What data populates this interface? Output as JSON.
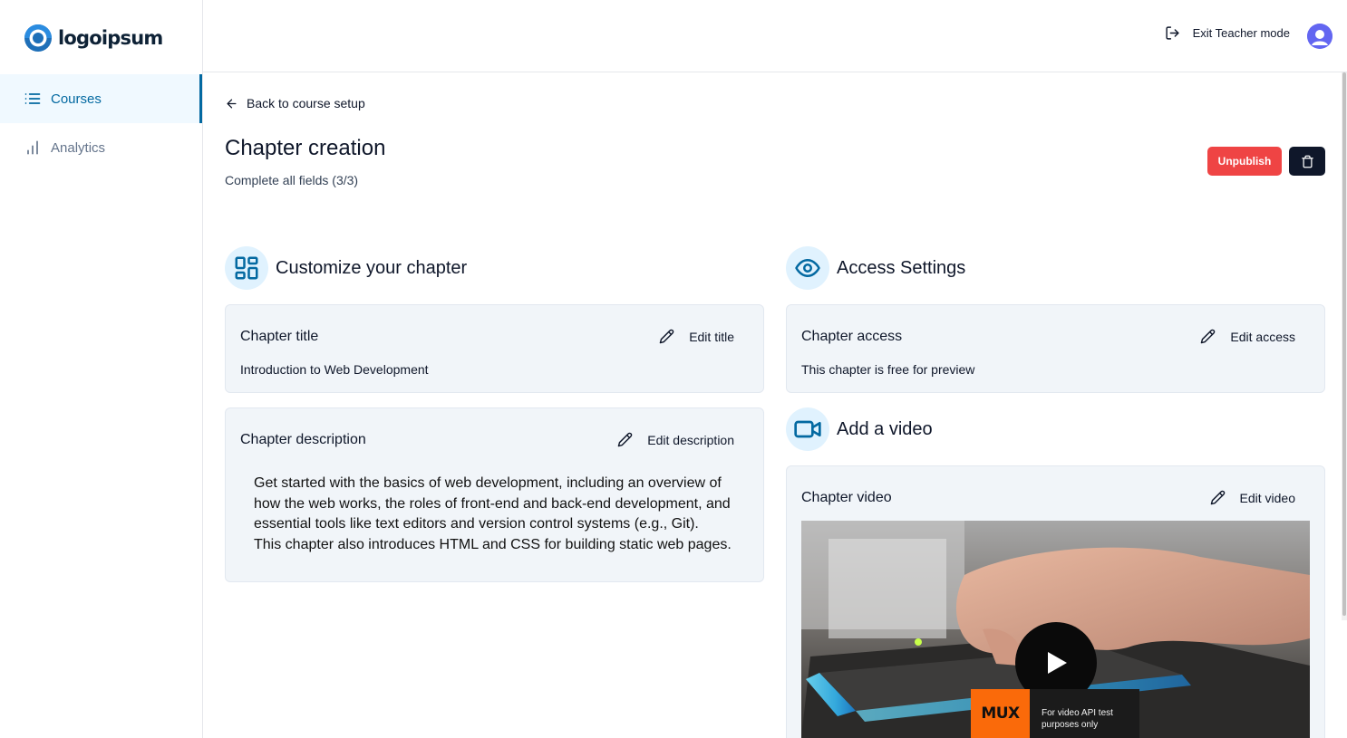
{
  "brand": {
    "name": "logoipsum",
    "accent": "#0369a1"
  },
  "sidebar": {
    "items": [
      {
        "label": "Courses",
        "icon": "list-icon",
        "active": true
      },
      {
        "label": "Analytics",
        "icon": "bar-chart-icon",
        "active": false
      }
    ]
  },
  "header": {
    "exit_label": "Exit Teacher mode",
    "exit_icon": "log-out-icon",
    "avatar_icon": "user-avatar-icon"
  },
  "page": {
    "back_label": "Back to course setup",
    "title": "Chapter creation",
    "subtitle": "Complete all fields (3/3)",
    "unpublish_label": "Unpublish",
    "delete_icon": "trash-icon"
  },
  "customize": {
    "heading": "Customize your chapter",
    "icon": "layout-dashboard-icon",
    "title_card": {
      "label": "Chapter title",
      "edit_label": "Edit title",
      "value": "Introduction to Web Development"
    },
    "description_card": {
      "label": "Chapter description",
      "edit_label": "Edit description",
      "lines": [
        "Get started with the basics of web development, including an overview of",
        "how the web works, the roles of front-end and back-end development, and",
        "essential tools like text editors and version control systems (e.g., Git).",
        "This chapter also introduces HTML and CSS for building static web pages."
      ]
    }
  },
  "access": {
    "heading": "Access Settings",
    "icon": "eye-icon",
    "card": {
      "label": "Chapter access",
      "edit_label": "Edit access",
      "value": "This chapter is free for preview"
    }
  },
  "video": {
    "heading": "Add a video",
    "icon": "video-camera-icon",
    "card": {
      "label": "Chapter video",
      "edit_label": "Edit video"
    },
    "player": {
      "badge": "MUX",
      "note_line1": "For video API test",
      "note_line2": "purposes only"
    }
  },
  "colors": {
    "danger": "#ef4444",
    "dark": "#0f172a",
    "card_bg": "#f1f5f9",
    "icon_bg": "#e0f2fe"
  }
}
